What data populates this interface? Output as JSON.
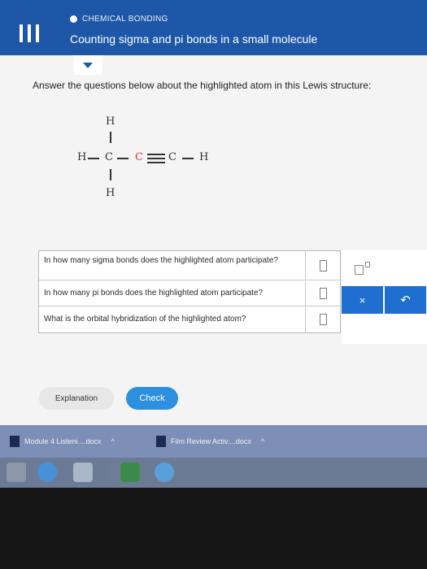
{
  "header": {
    "topic": "CHEMICAL BONDING",
    "title": "Counting sigma and pi bonds in a small molecule"
  },
  "prompt": "Answer the questions below about the highlighted atom in this Lewis structure:",
  "lewis": {
    "top_h": "H",
    "left_h": "H",
    "c1": "C",
    "c2": "C",
    "c3": "C",
    "right_h": "H",
    "bottom_h": "H",
    "highlight_color": "#d23a3a"
  },
  "questions": [
    {
      "text": "In how many sigma bonds does the highlighted atom participate?"
    },
    {
      "text": "In how many pi bonds does the highlighted atom participate?"
    },
    {
      "text": "What is the orbital hybridization of the highlighted atom?"
    }
  ],
  "tools": {
    "clear_label": "×",
    "undo_label": "↶"
  },
  "buttons": {
    "explanation": "Explanation",
    "check": "Check"
  },
  "downloads": [
    {
      "name": "Module 4 Listeni....docx"
    },
    {
      "name": "Film Review Activ....docx"
    }
  ],
  "colors": {
    "header": "#1e57a8",
    "accent": "#2d8fe0"
  }
}
